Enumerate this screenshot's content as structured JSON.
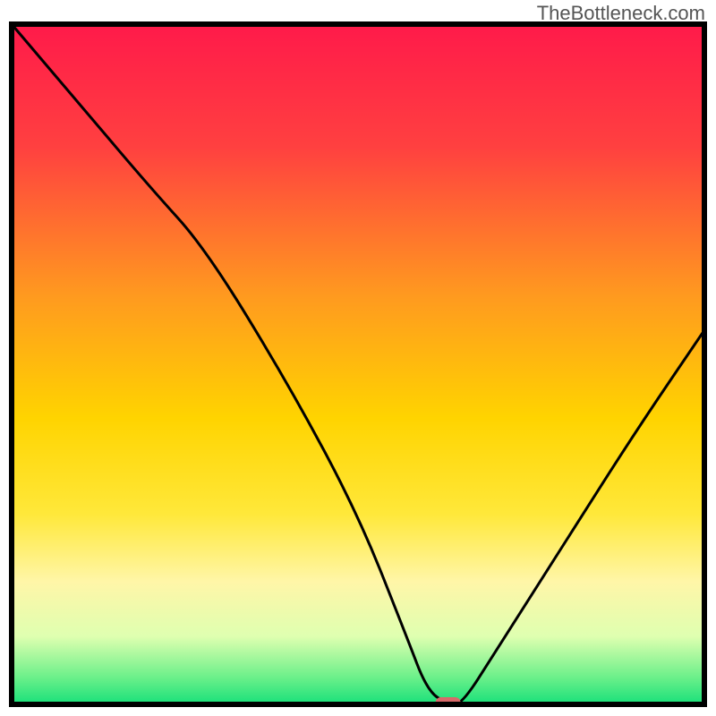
{
  "watermark": "TheBottleneck.com",
  "chart_data": {
    "type": "line",
    "title": "",
    "xlabel": "",
    "ylabel": "",
    "xlim": [
      0,
      100
    ],
    "ylim": [
      0,
      100
    ],
    "series": [
      {
        "name": "bottleneck-curve",
        "x": [
          0,
          10,
          20,
          28,
          40,
          50,
          57,
          60,
          63,
          65,
          70,
          80,
          90,
          100
        ],
        "values": [
          100,
          88,
          76,
          67,
          47,
          28,
          10,
          2,
          0,
          0,
          8,
          24,
          40,
          55
        ]
      }
    ],
    "marker": {
      "x": 63,
      "y": 0,
      "color": "#d86a6a"
    },
    "gradient_stops": [
      {
        "offset": 0.0,
        "color": "#ff1a4a"
      },
      {
        "offset": 0.18,
        "color": "#ff4040"
      },
      {
        "offset": 0.4,
        "color": "#ff9a1f"
      },
      {
        "offset": 0.58,
        "color": "#ffd400"
      },
      {
        "offset": 0.72,
        "color": "#ffe83a"
      },
      {
        "offset": 0.82,
        "color": "#fff6a8"
      },
      {
        "offset": 0.9,
        "color": "#dfffb0"
      },
      {
        "offset": 0.96,
        "color": "#6cf08a"
      },
      {
        "offset": 1.0,
        "color": "#18e07a"
      }
    ],
    "frame_color": "#000000",
    "line_color": "#000000"
  }
}
